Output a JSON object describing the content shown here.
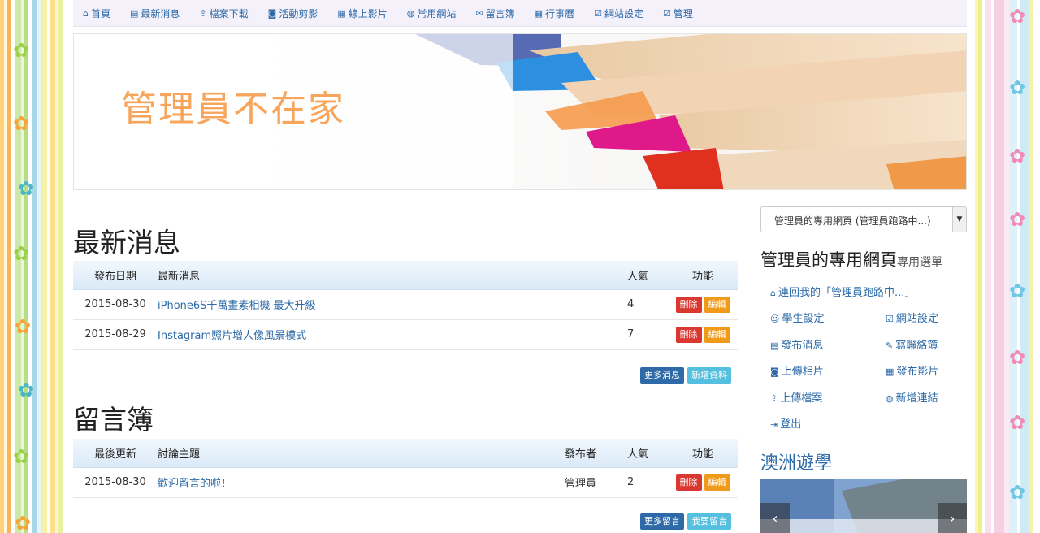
{
  "nav": [
    {
      "icon": "home-icon",
      "glyph": "⌂",
      "label": "首頁"
    },
    {
      "icon": "newspaper-icon",
      "glyph": "▤",
      "label": "最新消息"
    },
    {
      "icon": "upload-icon",
      "glyph": "⇪",
      "label": "檔案下載"
    },
    {
      "icon": "camera-icon",
      "glyph": "◙",
      "label": "活動剪影"
    },
    {
      "icon": "film-icon",
      "glyph": "▦",
      "label": "線上影片"
    },
    {
      "icon": "globe-icon",
      "glyph": "◍",
      "label": "常用網站"
    },
    {
      "icon": "comments-icon",
      "glyph": "✉",
      "label": "留言簿"
    },
    {
      "icon": "calendar-icon",
      "glyph": "▦",
      "label": "行事曆"
    },
    {
      "icon": "check-square-icon",
      "glyph": "☑",
      "label": "網站設定"
    },
    {
      "icon": "check-square-icon",
      "glyph": "☑",
      "label": "管理"
    }
  ],
  "banner": {
    "title": "管理員不在家"
  },
  "news": {
    "title": "最新消息",
    "headers": {
      "date": "發布日期",
      "subject": "最新消息",
      "hits": "人氣",
      "action": "功能"
    },
    "rows": [
      {
        "date": "2015-08-30",
        "subject": "iPhone6S千萬畫素相機 最大升級",
        "hits": "4"
      },
      {
        "date": "2015-08-29",
        "subject": "Instagram照片增人像風景模式",
        "hits": "7"
      }
    ],
    "more_label": "更多消息",
    "add_label": "新增資料"
  },
  "guestbook": {
    "title": "留言簿",
    "headers": {
      "date": "最後更新",
      "subject": "討論主題",
      "author": "發布者",
      "hits": "人氣",
      "action": "功能"
    },
    "rows": [
      {
        "date": "2015-08-30",
        "subject": "歡迎留言的啦！",
        "author": "管理員",
        "hits": "2"
      }
    ],
    "more_label": "更多留言",
    "add_label": "我要留言"
  },
  "row_actions": {
    "delete_label": "刪除",
    "edit_label": "編輯"
  },
  "sidebar": {
    "select_value": "管理員的專用網頁 (管理員跑路中...)",
    "menu_title": "管理員的專用網頁",
    "menu_sub": "專用選單",
    "back_link": "連回我的「管理員跑路中...」",
    "links": [
      {
        "icon": "smile-icon",
        "glyph": "☺",
        "label": "學生設定"
      },
      {
        "icon": "check-square-icon",
        "glyph": "☑",
        "label": "網站設定"
      },
      {
        "icon": "newspaper-icon",
        "glyph": "▤",
        "label": "發布消息"
      },
      {
        "icon": "edit-icon",
        "glyph": "✎",
        "label": "寫聯絡簿"
      },
      {
        "icon": "camera-icon",
        "glyph": "◙",
        "label": "上傳相片"
      },
      {
        "icon": "film-icon",
        "glyph": "▦",
        "label": "發布影片"
      },
      {
        "icon": "upload-icon",
        "glyph": "⇪",
        "label": "上傳檔案"
      },
      {
        "icon": "globe-icon",
        "glyph": "◍",
        "label": "新增連結"
      },
      {
        "icon": "sign-out-icon",
        "glyph": "⇥",
        "label": "登出"
      }
    ],
    "album_title": "澳洲遊學"
  },
  "colors": {
    "link": "#2c6aa8",
    "banner_text": "#f6a55a",
    "delete": "#d9372f",
    "edit": "#ef9a1b"
  }
}
